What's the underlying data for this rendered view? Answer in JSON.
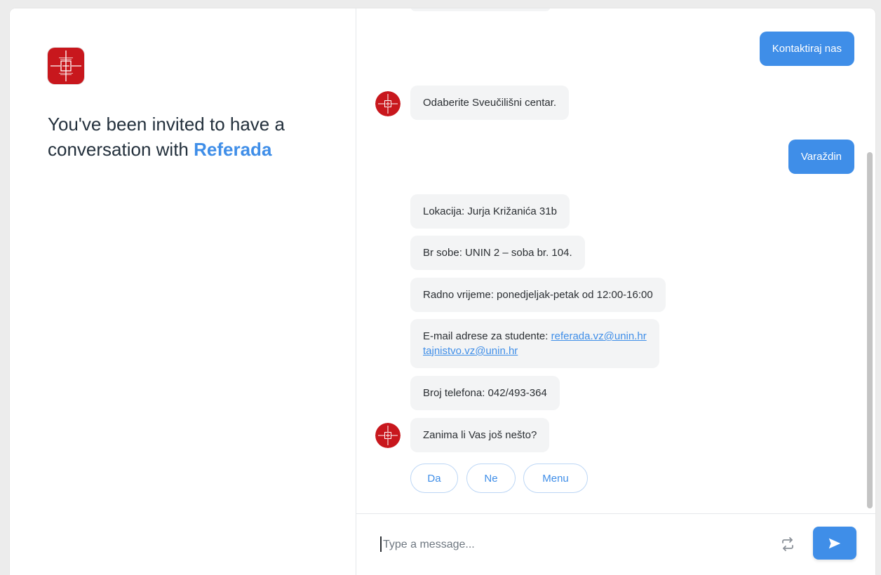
{
  "invite": {
    "text": "You've been invited to have a conversation with",
    "bot_name": "Referada"
  },
  "messages": [
    {
      "from": "user",
      "text": "Kontaktiraj nas"
    },
    {
      "from": "bot",
      "text": "Odaberite Sveučilišni centar."
    },
    {
      "from": "user",
      "text": "Varaždin"
    },
    {
      "from": "bot",
      "text": "Lokacija: Jurja Križanića 31b"
    },
    {
      "from": "bot",
      "text": "Br sobe: UNIN 2 – soba br. 104."
    },
    {
      "from": "bot",
      "text": "Radno vrijeme: ponedjeljak-petak od 12:00-16:00"
    },
    {
      "from": "bot",
      "text": "E-mail adrese za studente:",
      "links": [
        "referada.vz@unin.hr",
        "tajnistvo.vz@unin.hr"
      ]
    },
    {
      "from": "bot",
      "text": "Broj telefona: 042/493-364"
    },
    {
      "from": "bot",
      "text": "Zanima li Vas još nešto?"
    }
  ],
  "quick_replies": [
    "Da",
    "Ne",
    "Menu"
  ],
  "composer": {
    "placeholder": "Type a message..."
  },
  "icons": {
    "logo": "university-logo-icon",
    "refresh": "refresh-icon",
    "send": "send-icon"
  },
  "colors": {
    "accent": "#3f8ee8",
    "bot_bubble": "#f3f4f5",
    "logo_red": "#c8171d"
  }
}
